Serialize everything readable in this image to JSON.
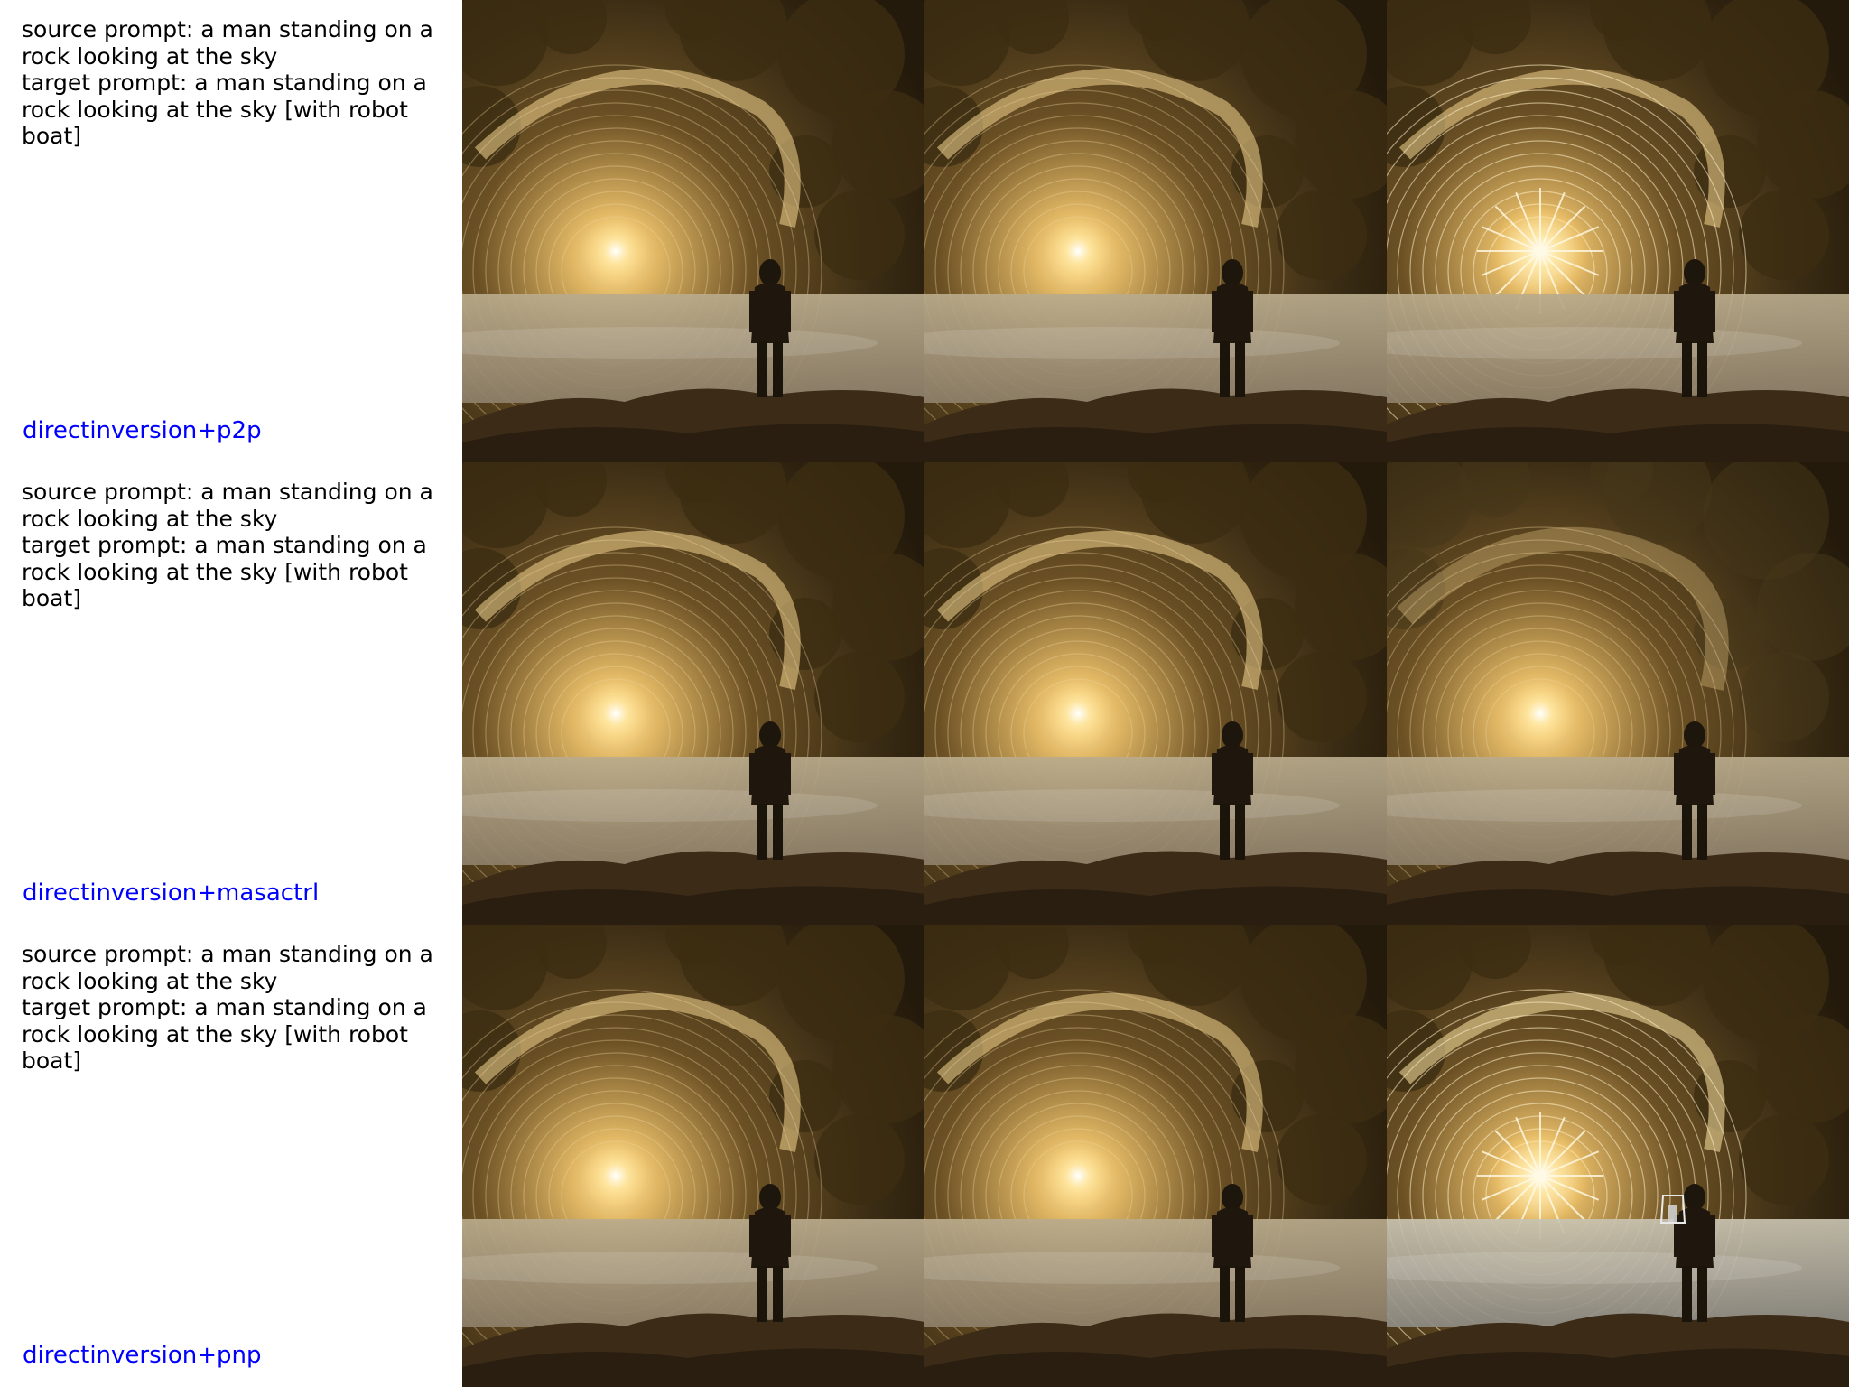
{
  "rows": [
    {
      "source_prompt": "source prompt: a man standing on a rock looking at the sky",
      "target_prompt": "target prompt: a man standing on a rock looking at the sky [with robot boat]",
      "method": "directinversion+p2p"
    },
    {
      "source_prompt": "source prompt: a man standing on a rock looking at the sky",
      "target_prompt": "target prompt: a man standing on a rock looking at the sky [with robot boat]",
      "method": "directinversion+masactrl"
    },
    {
      "source_prompt": "source prompt: a man standing on a rock looking at the sky",
      "target_prompt": "target prompt: a man standing on a rock looking at the sky [with robot boat]",
      "method": "directinversion+pnp"
    }
  ],
  "colors": {
    "label_text": "#000000",
    "method_text": "#0000ff",
    "background": "#ffffff"
  }
}
